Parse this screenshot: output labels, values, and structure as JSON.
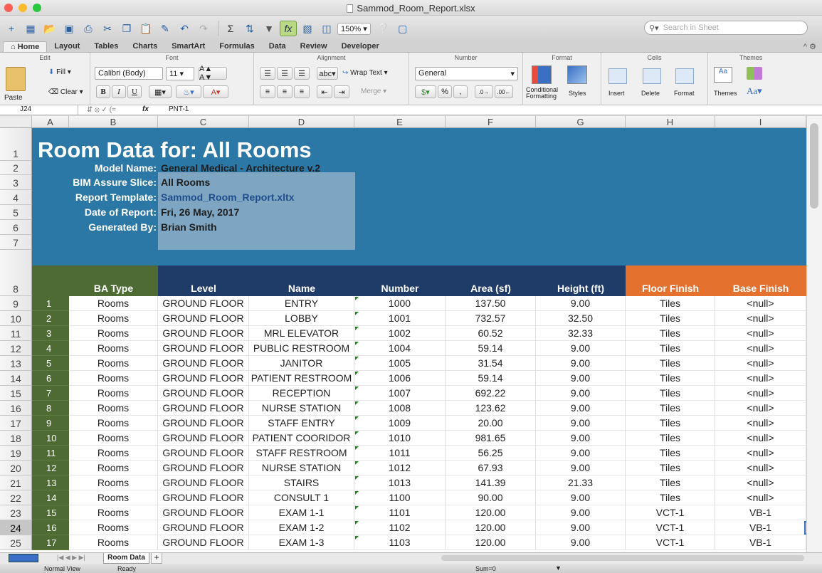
{
  "window": {
    "title": "Sammod_Room_Report.xlsx"
  },
  "toolbar": {
    "zoom": "150%",
    "search_placeholder": "Search in Sheet",
    "colors": {
      "brand": "#2b78a6"
    }
  },
  "ribbon": {
    "tabs": [
      "Home",
      "Layout",
      "Tables",
      "Charts",
      "SmartArt",
      "Formulas",
      "Data",
      "Review",
      "Developer"
    ],
    "groups": {
      "edit": "Edit",
      "font": "Font",
      "alignment": "Alignment",
      "number": "Number",
      "format": "Format",
      "cells": "Cells",
      "themes": "Themes"
    },
    "paste": "Paste",
    "fill": "Fill",
    "clear": "Clear",
    "font_name": "Calibri (Body)",
    "font_size": "11",
    "wrap_text": "Wrap Text",
    "merge": "Merge",
    "number_format": "General",
    "conditional_formatting": "Conditional Formatting",
    "styles": "Styles",
    "insert": "Insert",
    "delete": "Delete",
    "format_btn": "Format",
    "themes_btn": "Themes"
  },
  "formula_bar": {
    "cell_ref": "J24",
    "formula": "PNT-1"
  },
  "sheet": {
    "columns": [
      "A",
      "B",
      "C",
      "D",
      "E",
      "F",
      "G",
      "H",
      "I"
    ],
    "rows": [
      "1",
      "2",
      "3",
      "4",
      "5",
      "6",
      "7",
      "8",
      "9",
      "10",
      "11",
      "12",
      "13",
      "14",
      "15",
      "16",
      "17",
      "18",
      "19",
      "20",
      "21",
      "22",
      "23",
      "24",
      "25"
    ],
    "title": "Room Data for:  All Rooms",
    "info": [
      {
        "label": "Model Name:",
        "value": "General Medical - Architecture  v.2"
      },
      {
        "label": "BIM Assure Slice:",
        "value": "All Rooms"
      },
      {
        "label": "Report Template:",
        "value": "Sammod_Room_Report.xltx"
      },
      {
        "label": "Date of Report:",
        "value": "Fri, 26 May, 2017"
      },
      {
        "label": "Generated By:",
        "value": "Brian Smith"
      }
    ],
    "headers": [
      "BA Type",
      "Level",
      "Name",
      "Number",
      "Area (sf)",
      "Height (ft)",
      "Floor Finish",
      "Base Finish"
    ],
    "data": [
      [
        "1",
        "Rooms",
        "GROUND FLOOR",
        "ENTRY",
        "1000",
        "137.50",
        "9.00",
        "Tiles",
        "<null>"
      ],
      [
        "2",
        "Rooms",
        "GROUND FLOOR",
        "LOBBY",
        "1001",
        "732.57",
        "32.50",
        "Tiles",
        "<null>"
      ],
      [
        "3",
        "Rooms",
        "GROUND FLOOR",
        "MRL ELEVATOR",
        "1002",
        "60.52",
        "32.33",
        "Tiles",
        "<null>"
      ],
      [
        "4",
        "Rooms",
        "GROUND FLOOR",
        "PUBLIC RESTROOM",
        "1004",
        "59.14",
        "9.00",
        "Tiles",
        "<null>"
      ],
      [
        "5",
        "Rooms",
        "GROUND FLOOR",
        "JANITOR",
        "1005",
        "31.54",
        "9.00",
        "Tiles",
        "<null>"
      ],
      [
        "6",
        "Rooms",
        "GROUND FLOOR",
        "PATIENT RESTROOM",
        "1006",
        "59.14",
        "9.00",
        "Tiles",
        "<null>"
      ],
      [
        "7",
        "Rooms",
        "GROUND FLOOR",
        "RECEPTION",
        "1007",
        "692.22",
        "9.00",
        "Tiles",
        "<null>"
      ],
      [
        "8",
        "Rooms",
        "GROUND FLOOR",
        "NURSE STATION",
        "1008",
        "123.62",
        "9.00",
        "Tiles",
        "<null>"
      ],
      [
        "9",
        "Rooms",
        "GROUND FLOOR",
        "STAFF ENTRY",
        "1009",
        "20.00",
        "9.00",
        "Tiles",
        "<null>"
      ],
      [
        "10",
        "Rooms",
        "GROUND FLOOR",
        "PATIENT COORIDOR",
        "1010",
        "981.65",
        "9.00",
        "Tiles",
        "<null>"
      ],
      [
        "11",
        "Rooms",
        "GROUND FLOOR",
        "STAFF RESTROOM",
        "1011",
        "56.25",
        "9.00",
        "Tiles",
        "<null>"
      ],
      [
        "12",
        "Rooms",
        "GROUND FLOOR",
        "NURSE STATION",
        "1012",
        "67.93",
        "9.00",
        "Tiles",
        "<null>"
      ],
      [
        "13",
        "Rooms",
        "GROUND FLOOR",
        "STAIRS",
        "1013",
        "141.39",
        "21.33",
        "Tiles",
        "<null>"
      ],
      [
        "14",
        "Rooms",
        "GROUND FLOOR",
        "CONSULT 1",
        "1100",
        "90.00",
        "9.00",
        "Tiles",
        "<null>"
      ],
      [
        "15",
        "Rooms",
        "GROUND FLOOR",
        "EXAM 1-1",
        "1101",
        "120.00",
        "9.00",
        "VCT-1",
        "VB-1"
      ],
      [
        "16",
        "Rooms",
        "GROUND FLOOR",
        "EXAM 1-2",
        "1102",
        "120.00",
        "9.00",
        "VCT-1",
        "VB-1"
      ],
      [
        "17",
        "Rooms",
        "GROUND FLOOR",
        "EXAM 1-3",
        "1103",
        "120.00",
        "9.00",
        "VCT-1",
        "VB-1"
      ]
    ]
  },
  "sheet_tab": "Room Data",
  "status": {
    "view": "Normal View",
    "state": "Ready",
    "sum": "Sum=0"
  }
}
